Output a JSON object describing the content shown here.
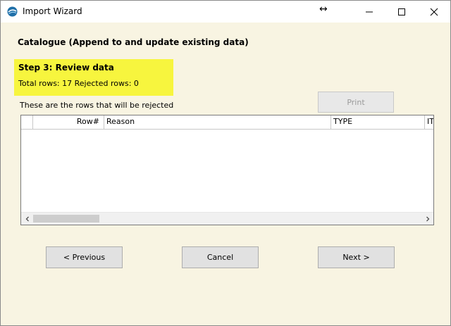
{
  "window": {
    "title": "Import Wizard",
    "resize_icon": "↔"
  },
  "page": {
    "section_title": "Catalogue (Append to and update existing data)",
    "step_title": "Step 3:  Review data",
    "step_stats": "Total rows: 17  Rejected rows: 0",
    "rows_caption": "These are the rows that will be rejected"
  },
  "grid": {
    "columns": [
      "",
      "Row#",
      "Reason",
      "TYPE",
      "IT"
    ],
    "rows": []
  },
  "buttons": {
    "print": "Print",
    "previous": "< Previous",
    "cancel": "Cancel",
    "next": "Next >"
  },
  "colors": {
    "background": "#f8f4e2",
    "highlight": "#f7f53e"
  }
}
